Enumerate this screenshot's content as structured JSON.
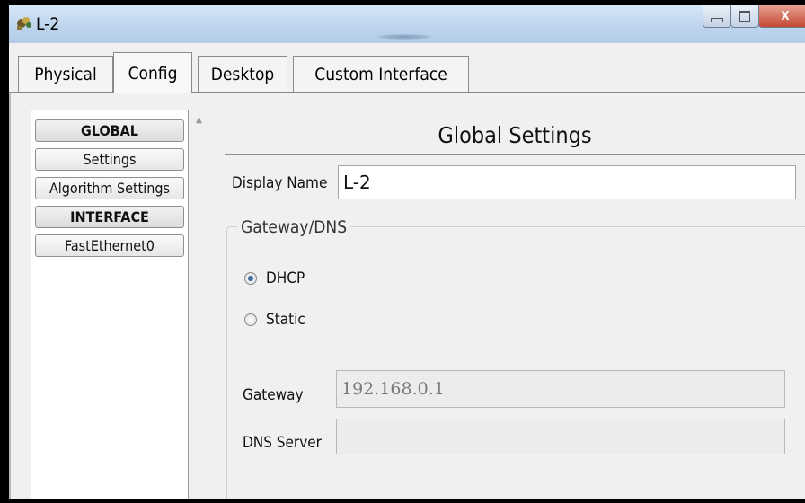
{
  "window": {
    "title": "L-2"
  },
  "tabs": [
    {
      "label": "Physical"
    },
    {
      "label": "Config"
    },
    {
      "label": "Desktop"
    },
    {
      "label": "Custom Interface"
    }
  ],
  "active_tab": "Config",
  "sidebar": {
    "items": [
      {
        "label": "GLOBAL",
        "header": true
      },
      {
        "label": "Settings",
        "header": false
      },
      {
        "label": "Algorithm Settings",
        "header": false
      },
      {
        "label": "INTERFACE",
        "header": true
      },
      {
        "label": "FastEthernet0",
        "header": false
      }
    ]
  },
  "main": {
    "title": "Global Settings",
    "display_name_label": "Display Name",
    "display_name_value": "L-2",
    "gateway_dns": {
      "legend": "Gateway/DNS",
      "dhcp_label": "DHCP",
      "static_label": "Static",
      "selected": "DHCP",
      "gateway_label": "Gateway",
      "gateway_value": "192.168.0.1",
      "dns_label": "DNS Server",
      "dns_value": ""
    }
  },
  "window_controls": {
    "close_symbol": "X"
  }
}
